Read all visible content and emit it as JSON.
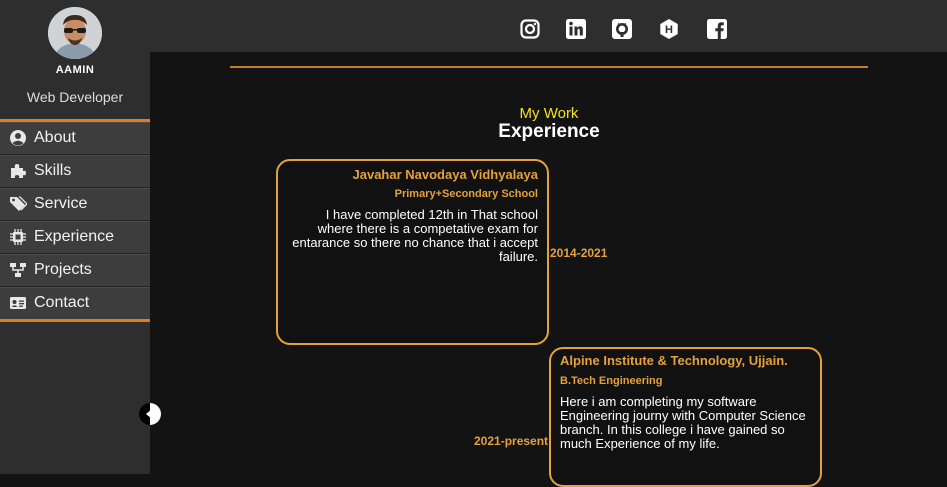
{
  "profile": {
    "name": "AAMIN",
    "role": "Web Developer"
  },
  "nav": {
    "items": [
      {
        "label": "About",
        "icon": "user-circle-icon"
      },
      {
        "label": "Skills",
        "icon": "puzzle-icon"
      },
      {
        "label": "Service",
        "icon": "tags-icon"
      },
      {
        "label": "Experience",
        "icon": "chip-icon"
      },
      {
        "label": "Projects",
        "icon": "sitemap-icon"
      },
      {
        "label": "Contact",
        "icon": "id-card-icon"
      }
    ]
  },
  "social": [
    "instagram-icon",
    "linkedin-icon",
    "github-icon",
    "hashnode-icon",
    "facebook-icon"
  ],
  "section": {
    "kicker": "My Work",
    "title": "Experience"
  },
  "experience": [
    {
      "org": "Javahar Navodaya Vidhyalaya",
      "level": "Primary+Secondary School",
      "desc": "I have completed 12th in That school where there is a competative exam for entarance so there no chance that i accept failure.",
      "period": "2014-2021"
    },
    {
      "org": "Alpine Institute & Technology, Ujjain.",
      "level": "B.Tech Engineering",
      "desc": "Here i am completing my software Engineering journy with Computer Science branch. In this college i have gained so much Experience of my life.",
      "period": "2021-present"
    }
  ],
  "colors": {
    "accent": "#e5a13a",
    "divider": "#e07b24",
    "kicker": "#f5e21d",
    "sidebar": "#2e2e2e",
    "background": "#131313"
  }
}
